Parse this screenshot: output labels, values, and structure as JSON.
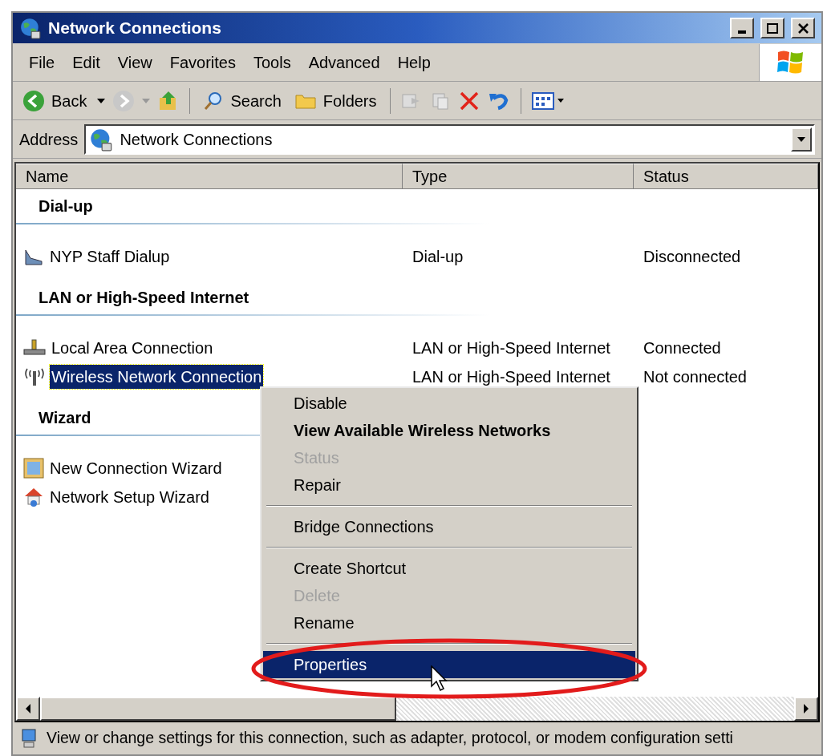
{
  "window": {
    "title": "Network Connections"
  },
  "menu_bar": [
    "File",
    "Edit",
    "View",
    "Favorites",
    "Tools",
    "Advanced",
    "Help"
  ],
  "toolbar": {
    "back": "Back",
    "search": "Search",
    "folders": "Folders"
  },
  "address": {
    "label": "Address",
    "value": "Network Connections"
  },
  "columns": [
    "Name",
    "Type",
    "Status"
  ],
  "groups": [
    {
      "title": "Dial-up",
      "items": [
        {
          "kind": "dialup",
          "name": "NYP Staff Dialup",
          "type": "Dial-up",
          "status": "Disconnected",
          "selected": false
        }
      ]
    },
    {
      "title": "LAN or High-Speed Internet",
      "items": [
        {
          "kind": "lan",
          "name": "Local Area Connection",
          "type": "LAN or High-Speed Internet",
          "status": "Connected",
          "selected": false
        },
        {
          "kind": "wireless",
          "name": "Wireless Network Connection",
          "type": "LAN or High-Speed Internet",
          "status": "Not connected",
          "selected": true
        }
      ]
    },
    {
      "title": "Wizard",
      "items": [
        {
          "kind": "wizard",
          "name": "New Connection Wizard",
          "selected": false
        },
        {
          "kind": "setup",
          "name": "Network Setup Wizard",
          "selected": false
        }
      ]
    }
  ],
  "context_menu": {
    "sections": [
      [
        {
          "label": "Disable",
          "bold": false,
          "disabled": false,
          "selected": false
        },
        {
          "label": "View Available Wireless Networks",
          "bold": true,
          "disabled": false,
          "selected": false
        },
        {
          "label": "Status",
          "bold": false,
          "disabled": true,
          "selected": false
        },
        {
          "label": "Repair",
          "bold": false,
          "disabled": false,
          "selected": false
        }
      ],
      [
        {
          "label": "Bridge Connections",
          "bold": false,
          "disabled": false,
          "selected": false
        }
      ],
      [
        {
          "label": "Create Shortcut",
          "bold": false,
          "disabled": false,
          "selected": false
        },
        {
          "label": "Delete",
          "bold": false,
          "disabled": true,
          "selected": false
        },
        {
          "label": "Rename",
          "bold": false,
          "disabled": false,
          "selected": false
        }
      ],
      [
        {
          "label": "Properties",
          "bold": false,
          "disabled": false,
          "selected": true
        }
      ]
    ]
  },
  "status_bar": "View or change settings for this connection, such as adapter, protocol, or modem configuration setti"
}
